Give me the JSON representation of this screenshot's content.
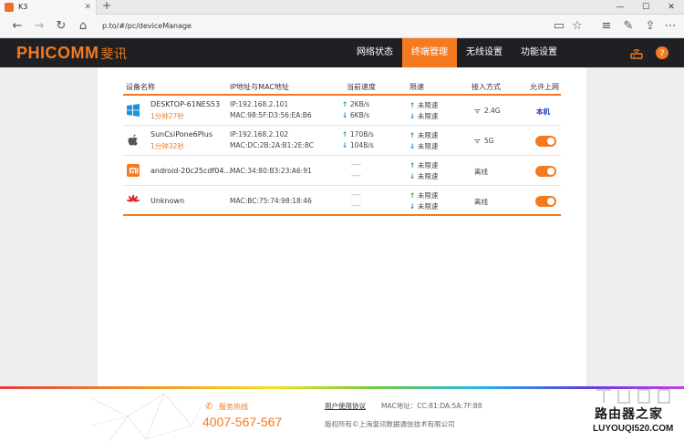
{
  "browser": {
    "tab_title": "K3",
    "tab_close": "✕",
    "new_tab": "+",
    "url": "p.to/#/pc/deviceManage",
    "window_buttons": [
      "—",
      "☐",
      "✕"
    ],
    "icons": [
      "back-arrow-icon",
      "forward-arrow-icon",
      "refresh-icon",
      "home-icon",
      "reading-view-icon",
      "favorite-star-icon",
      "hub-icon",
      "pen-icon",
      "share-icon",
      "more-icon"
    ]
  },
  "header": {
    "logo": "PHICOMM",
    "logo_cn": "斐讯",
    "menu": [
      {
        "label": "网络状态",
        "active": false
      },
      {
        "label": "终端管理",
        "active": true
      },
      {
        "label": "无线设置",
        "active": false
      },
      {
        "label": "功能设置",
        "active": false
      }
    ],
    "accent": "#f47a20"
  },
  "table": {
    "headers": {
      "name": "设备名称",
      "ip_mac": "IP地址与MAC地址",
      "speed": "当前速度",
      "limit": "限速",
      "access": "接入方式",
      "allow": "允许上网"
    },
    "rows": [
      {
        "icon": "windows-icon",
        "name": "DESKTOP-61NES53",
        "time": "1分钟27秒",
        "ip": "IP:192.168.2.101",
        "mac": "MAC:98:5F:D3:56:EA:B6",
        "up": "2KB/s",
        "down": "6KB/s",
        "limit_up": "未限速",
        "limit_down": "未限速",
        "access": "2.4G",
        "allow": "本机"
      },
      {
        "icon": "apple-icon",
        "name": "SunCsiPone6Plus",
        "time": "1分钟32秒",
        "ip": "IP:192.168.2.102",
        "mac": "MAC:DC:2B:2A:B1:2E:8C",
        "up": "170B/s",
        "down": "104B/s",
        "limit_up": "未限速",
        "limit_down": "未限速",
        "access": "5G",
        "allow": "on"
      },
      {
        "icon": "xiaomi-icon",
        "name": "android-20c25cdf04...",
        "mac": "MAC:34:80:B3:23:A6:91",
        "dash_up": "----",
        "dash_down": "----",
        "limit_up": "未限速",
        "limit_down": "未限速",
        "access": "离线",
        "allow": "on"
      },
      {
        "icon": "huawei-icon",
        "name": "Unknown",
        "mac": "MAC:BC:75:74:98:18:46",
        "dash_up": "----",
        "dash_down": "----",
        "limit_up": "未限速",
        "limit_down": "未限速",
        "access": "离线",
        "allow": "on"
      }
    ]
  },
  "footer": {
    "hotline_label": "服务热线",
    "hotline_number": "4007-567-567",
    "agreement": "用户使用协议",
    "mac_address": "MAC地址：CC:81:DA:5A:7F:B8",
    "copyright": "版权所有©上海斐讯数据通信技术有限公司"
  },
  "watermark": {
    "title": "路由器之家",
    "url": "LUYOUQI520.COM"
  }
}
